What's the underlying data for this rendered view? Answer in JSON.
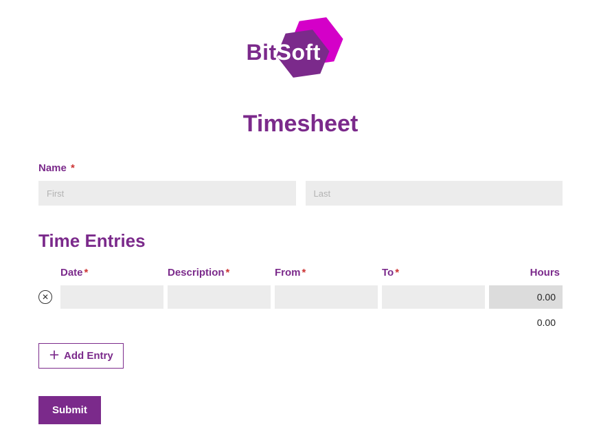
{
  "logo": {
    "bit": "Bit",
    "soft": "Soft"
  },
  "title": "Timesheet",
  "name": {
    "label": "Name",
    "required": "*",
    "first_placeholder": "First",
    "last_placeholder": "Last",
    "first_value": "",
    "last_value": ""
  },
  "entries": {
    "heading": "Time Entries",
    "columns": {
      "date": "Date",
      "description": "Description",
      "from": "From",
      "to": "To",
      "hours": "Hours",
      "required": "*"
    },
    "rows": [
      {
        "date": "",
        "description": "",
        "from": "",
        "to": "",
        "hours": "0.00"
      }
    ],
    "total": "0.00",
    "add_label": "Add Entry"
  },
  "submit_label": "Submit"
}
